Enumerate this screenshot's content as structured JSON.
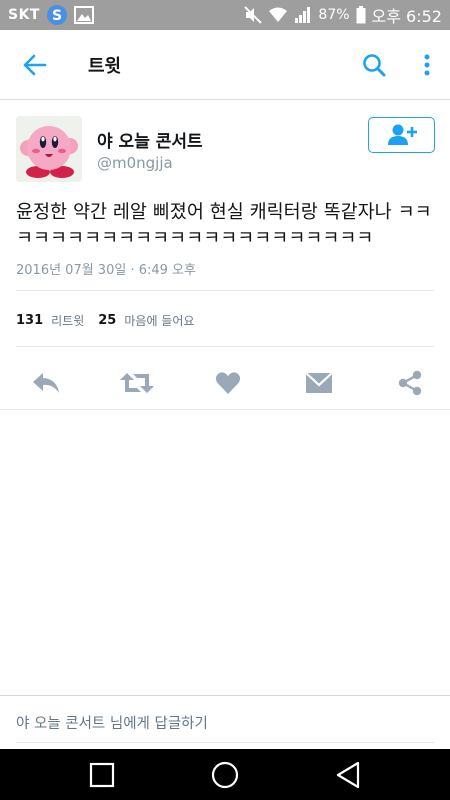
{
  "status_bar": {
    "carrier": "SKT",
    "battery": "87%",
    "time": "오후 6:52"
  },
  "app_bar": {
    "title": "트윗",
    "back_icon": "back-arrow-icon",
    "search_icon": "search-icon",
    "more_icon": "more-vertical-icon"
  },
  "tweet": {
    "display_name": "야 오늘 콘서트",
    "username": "@m0ngjja",
    "text": "윤정한 약간 레알 삐졌어 현실 캐릭터랑 똑같자나 ㅋㅋㅋㅋㅋㅋㅋㅋㅋㅋㅋㅋㅋㅋㅋㅋㅋㅋㅋㅋㅋㅋㅋ",
    "timestamp": "2016년 07월 30일 · 6:49 오후",
    "retweets_count": "131",
    "retweets_label": "리트윗",
    "likes_count": "25",
    "likes_label": "마음에 들어요"
  },
  "actions": [
    "reply-icon",
    "retweet-icon",
    "heart-icon",
    "message-icon",
    "share-icon"
  ],
  "reply_box": {
    "placeholder": "야 오늘 콘서트 님에게 답글하기"
  },
  "colors": {
    "accent": "#1da1f2",
    "icon_gray": "#9aa9b5",
    "status_bar": "#9e9e9e"
  }
}
